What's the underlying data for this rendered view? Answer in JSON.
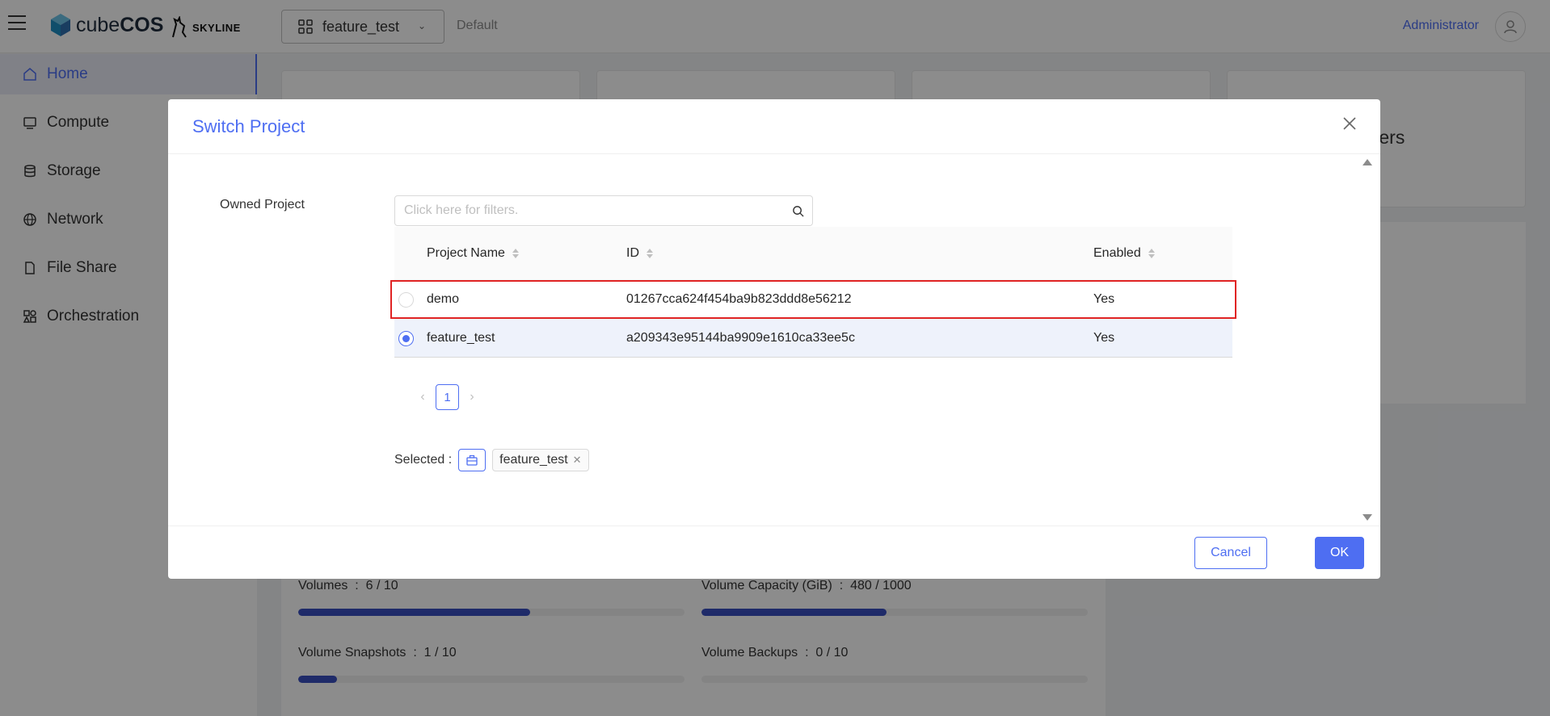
{
  "topbar": {
    "logo_text_light": "cube",
    "logo_text_bold": "COS",
    "skyline_text": "SKYLINE",
    "project": "feature_test",
    "domain": "Default",
    "user": "Administrator"
  },
  "sidebar": {
    "items": [
      {
        "label": "Home",
        "icon": "home-icon"
      },
      {
        "label": "Compute",
        "icon": "monitor-icon"
      },
      {
        "label": "Storage",
        "icon": "database-icon"
      },
      {
        "label": "Network",
        "icon": "globe-icon"
      },
      {
        "label": "File Share",
        "icon": "file-icon"
      },
      {
        "label": "Orchestration",
        "icon": "orchestration-icon"
      }
    ]
  },
  "background": {
    "peek_text": "ters",
    "usage": [
      {
        "label": "Volumes",
        "value": "6 / 10",
        "fraction": 0.6
      },
      {
        "label": "Volume Capacity (GiB)",
        "value": "480 / 1000",
        "fraction": 0.48
      },
      {
        "label": "Volume Snapshots",
        "value": "1 / 10",
        "fraction": 0.1
      },
      {
        "label": "Volume Backups",
        "value": "0 / 10",
        "fraction": 0.0
      }
    ]
  },
  "modal": {
    "title": "Switch Project",
    "owned_label": "Owned Project",
    "search_placeholder": "Click here for filters.",
    "columns": [
      "Project Name",
      "ID",
      "Enabled"
    ],
    "rows": [
      {
        "name": "demo",
        "id": "01267cca624f454ba9b823ddd8e56212",
        "enabled": "Yes",
        "checked": false
      },
      {
        "name": "feature_test",
        "id": "a209343e95144ba9909e1610ca33ee5c",
        "enabled": "Yes",
        "checked": true
      }
    ],
    "pagination": {
      "prev": "‹",
      "page": "1",
      "next": "›"
    },
    "selected_label": "Selected :",
    "selected_tag": "feature_test",
    "cancel": "Cancel",
    "ok": "OK"
  },
  "colors": {
    "accent": "#4e6ef2",
    "highlight": "#e02424",
    "bar": "#3a4fc0"
  }
}
